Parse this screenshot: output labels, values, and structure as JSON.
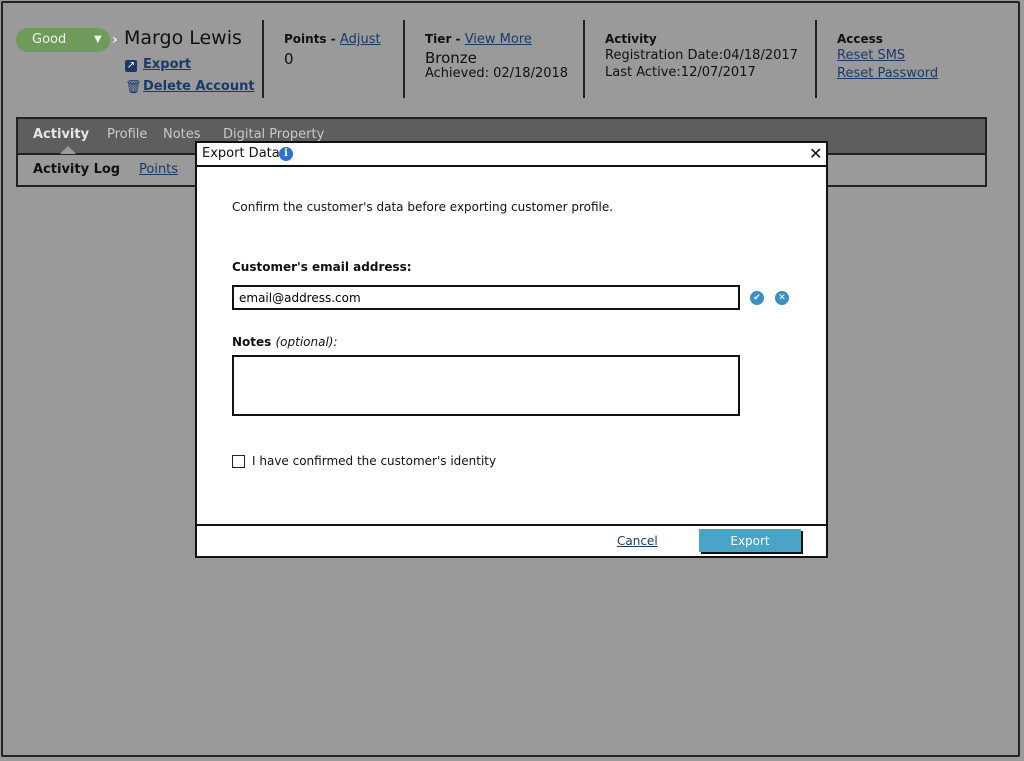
{
  "header": {
    "status": "Good",
    "customer_name": "Margo Lewis",
    "export_label": "Export",
    "delete_label": "Delete Account",
    "points": {
      "label": "Points - ",
      "adjust_link": "Adjust",
      "value": "0"
    },
    "tier": {
      "label": "Tier - ",
      "view_more_link": "View More",
      "value": "Bronze",
      "achieved": "Achieved: 02/18/2018"
    },
    "activity": {
      "label": "Activity",
      "registration": "Registration Date:04/18/2017",
      "last_active": "Last Active:12/07/2017"
    },
    "access": {
      "label": "Access",
      "reset_sms": "Reset SMS",
      "reset_password": "Reset Password"
    }
  },
  "tabs": [
    "Activity",
    "Profile",
    "Notes",
    "Digital Property"
  ],
  "subtabs": [
    "Activity Log",
    "Points"
  ],
  "modal": {
    "title": "Export Data",
    "confirm_text": "Confirm the customer's data before exporting customer profile.",
    "email_label": "Customer's email address:",
    "email_value": "email@address.com",
    "notes_label": "Notes ",
    "notes_optional": "(optional):",
    "notes_value": "",
    "checkbox_label": "I have confirmed the customer's identity",
    "checkbox_checked": false,
    "cancel_label": "Cancel",
    "export_label": "Export"
  },
  "colors": {
    "backdrop": "#9a9a9a",
    "status_good": "#6e9a5a",
    "link": "#1b3a6b",
    "primary_button": "#4aa4c8",
    "tabbar": "#5e5e5e"
  },
  "icons": {
    "status_caret": "chevron-down-icon",
    "status_next": "chevron-right-icon",
    "export": "export-icon",
    "delete": "trash-icon",
    "info": "info-icon",
    "close": "close-icon",
    "valid": "check-circle-icon",
    "clear": "clear-circle-icon"
  }
}
